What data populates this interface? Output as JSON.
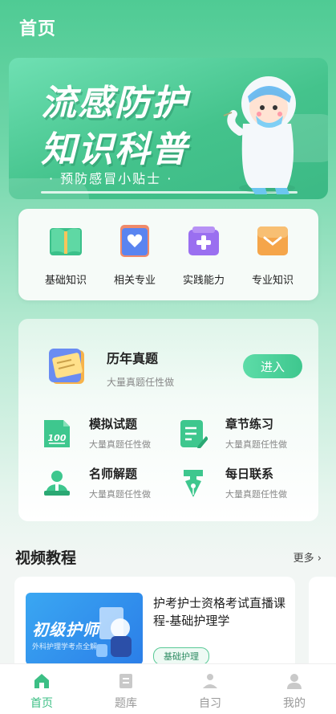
{
  "header": {
    "title": "首页"
  },
  "banner": {
    "line1": "流感防护",
    "line2": "知识科普",
    "subtitle": "· 预防感冒小贴士 ·"
  },
  "categories": [
    {
      "label": "基础知识",
      "icon": "book-open-icon",
      "color": "#3bc08a"
    },
    {
      "label": "相关专业",
      "icon": "heart-card-icon",
      "color": "#5a84f0"
    },
    {
      "label": "实践能力",
      "icon": "medical-kit-icon",
      "color": "#9a6ff0"
    },
    {
      "label": "专业知识",
      "icon": "envelope-icon",
      "color": "#f5a54a"
    }
  ],
  "exam": {
    "history": {
      "title": "历年真题",
      "desc": "大量真题任性做",
      "button": "进入"
    },
    "items": [
      {
        "title": "模拟试题",
        "desc": "大量真题任性做",
        "icon": "score-100-icon"
      },
      {
        "title": "章节练习",
        "desc": "大量真题任性做",
        "icon": "document-edit-icon"
      },
      {
        "title": "名师解题",
        "desc": "大量真题任性做",
        "icon": "teacher-icon"
      },
      {
        "title": "每日联系",
        "desc": "大量真题任性做",
        "icon": "pen-nib-icon"
      }
    ]
  },
  "video": {
    "heading": "视频教程",
    "more": "更多 ›",
    "card": {
      "thumb_title": "初级护师",
      "thumb_sub": "外科护理学考点全解",
      "title": "护考护士资格考试直播课程-基础护理学",
      "tag": "基础护理"
    }
  },
  "tabs": [
    {
      "label": "首页",
      "icon": "home-icon",
      "active": true
    },
    {
      "label": "题库",
      "icon": "question-bank-icon",
      "active": false
    },
    {
      "label": "自习",
      "icon": "study-icon",
      "active": false
    },
    {
      "label": "我的",
      "icon": "profile-icon",
      "active": false
    }
  ],
  "colors": {
    "accent": "#3ec78e",
    "text": "#222222",
    "muted": "#888888"
  }
}
